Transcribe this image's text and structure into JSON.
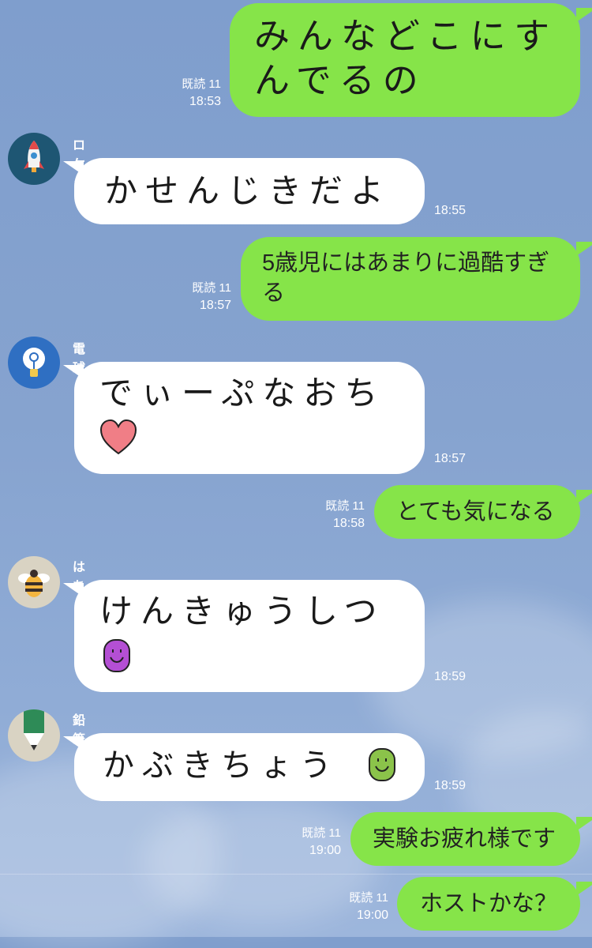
{
  "messages": [
    {
      "from": "me",
      "text": "みんなどこにすんでるの",
      "read": "既読 11",
      "time": "18:53"
    },
    {
      "from": "ロケット",
      "text": "かせんじきだよ",
      "time": "18:55"
    },
    {
      "from": "me",
      "text": "5歳児にはあまりに過酷すぎる",
      "read": "既読 11",
      "time": "18:57"
    },
    {
      "from": "電球",
      "text": "でぃーぷなおち",
      "time": "18:57"
    },
    {
      "from": "me",
      "text": "とても気になる",
      "read": "既読 11",
      "time": "18:58"
    },
    {
      "from": "はち",
      "text": "けんきゅうしつ",
      "time": "18:59"
    },
    {
      "from": "鉛筆",
      "text": "かぶきちょう",
      "time": "18:59"
    },
    {
      "from": "me",
      "text": "実験お疲れ様です",
      "read": "既読 11",
      "time": "19:00"
    },
    {
      "from": "me",
      "text": "ホストかな？",
      "read": "既読 11",
      "time": "19:00"
    }
  ],
  "icons": {
    "rocket": "rocket-icon",
    "bulb": "lightbulb-icon",
    "bee": "bee-icon",
    "pencil": "pencil-icon"
  },
  "colors": {
    "me_bubble": "#86e449",
    "other_bubble": "#ffffff",
    "background": "#86a3cf"
  }
}
